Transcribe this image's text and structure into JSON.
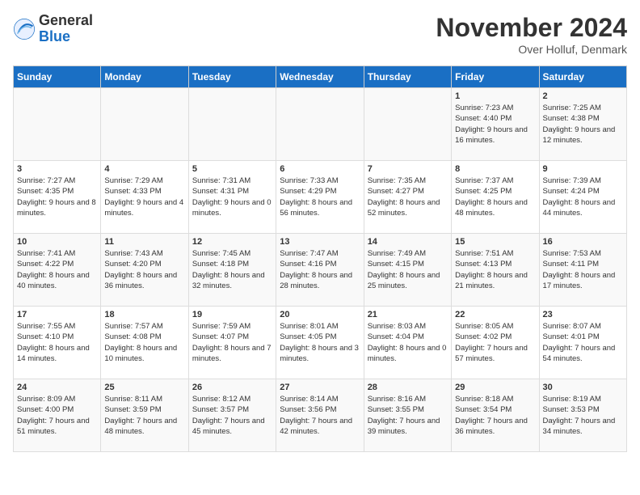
{
  "logo": {
    "general": "General",
    "blue": "Blue"
  },
  "title": "November 2024",
  "location": "Over Holluf, Denmark",
  "weekdays": [
    "Sunday",
    "Monday",
    "Tuesday",
    "Wednesday",
    "Thursday",
    "Friday",
    "Saturday"
  ],
  "weeks": [
    [
      {
        "day": "",
        "info": ""
      },
      {
        "day": "",
        "info": ""
      },
      {
        "day": "",
        "info": ""
      },
      {
        "day": "",
        "info": ""
      },
      {
        "day": "",
        "info": ""
      },
      {
        "day": "1",
        "info": "Sunrise: 7:23 AM\nSunset: 4:40 PM\nDaylight: 9 hours and 16 minutes."
      },
      {
        "day": "2",
        "info": "Sunrise: 7:25 AM\nSunset: 4:38 PM\nDaylight: 9 hours and 12 minutes."
      }
    ],
    [
      {
        "day": "3",
        "info": "Sunrise: 7:27 AM\nSunset: 4:35 PM\nDaylight: 9 hours and 8 minutes."
      },
      {
        "day": "4",
        "info": "Sunrise: 7:29 AM\nSunset: 4:33 PM\nDaylight: 9 hours and 4 minutes."
      },
      {
        "day": "5",
        "info": "Sunrise: 7:31 AM\nSunset: 4:31 PM\nDaylight: 9 hours and 0 minutes."
      },
      {
        "day": "6",
        "info": "Sunrise: 7:33 AM\nSunset: 4:29 PM\nDaylight: 8 hours and 56 minutes."
      },
      {
        "day": "7",
        "info": "Sunrise: 7:35 AM\nSunset: 4:27 PM\nDaylight: 8 hours and 52 minutes."
      },
      {
        "day": "8",
        "info": "Sunrise: 7:37 AM\nSunset: 4:25 PM\nDaylight: 8 hours and 48 minutes."
      },
      {
        "day": "9",
        "info": "Sunrise: 7:39 AM\nSunset: 4:24 PM\nDaylight: 8 hours and 44 minutes."
      }
    ],
    [
      {
        "day": "10",
        "info": "Sunrise: 7:41 AM\nSunset: 4:22 PM\nDaylight: 8 hours and 40 minutes."
      },
      {
        "day": "11",
        "info": "Sunrise: 7:43 AM\nSunset: 4:20 PM\nDaylight: 8 hours and 36 minutes."
      },
      {
        "day": "12",
        "info": "Sunrise: 7:45 AM\nSunset: 4:18 PM\nDaylight: 8 hours and 32 minutes."
      },
      {
        "day": "13",
        "info": "Sunrise: 7:47 AM\nSunset: 4:16 PM\nDaylight: 8 hours and 28 minutes."
      },
      {
        "day": "14",
        "info": "Sunrise: 7:49 AM\nSunset: 4:15 PM\nDaylight: 8 hours and 25 minutes."
      },
      {
        "day": "15",
        "info": "Sunrise: 7:51 AM\nSunset: 4:13 PM\nDaylight: 8 hours and 21 minutes."
      },
      {
        "day": "16",
        "info": "Sunrise: 7:53 AM\nSunset: 4:11 PM\nDaylight: 8 hours and 17 minutes."
      }
    ],
    [
      {
        "day": "17",
        "info": "Sunrise: 7:55 AM\nSunset: 4:10 PM\nDaylight: 8 hours and 14 minutes."
      },
      {
        "day": "18",
        "info": "Sunrise: 7:57 AM\nSunset: 4:08 PM\nDaylight: 8 hours and 10 minutes."
      },
      {
        "day": "19",
        "info": "Sunrise: 7:59 AM\nSunset: 4:07 PM\nDaylight: 8 hours and 7 minutes."
      },
      {
        "day": "20",
        "info": "Sunrise: 8:01 AM\nSunset: 4:05 PM\nDaylight: 8 hours and 3 minutes."
      },
      {
        "day": "21",
        "info": "Sunrise: 8:03 AM\nSunset: 4:04 PM\nDaylight: 8 hours and 0 minutes."
      },
      {
        "day": "22",
        "info": "Sunrise: 8:05 AM\nSunset: 4:02 PM\nDaylight: 7 hours and 57 minutes."
      },
      {
        "day": "23",
        "info": "Sunrise: 8:07 AM\nSunset: 4:01 PM\nDaylight: 7 hours and 54 minutes."
      }
    ],
    [
      {
        "day": "24",
        "info": "Sunrise: 8:09 AM\nSunset: 4:00 PM\nDaylight: 7 hours and 51 minutes."
      },
      {
        "day": "25",
        "info": "Sunrise: 8:11 AM\nSunset: 3:59 PM\nDaylight: 7 hours and 48 minutes."
      },
      {
        "day": "26",
        "info": "Sunrise: 8:12 AM\nSunset: 3:57 PM\nDaylight: 7 hours and 45 minutes."
      },
      {
        "day": "27",
        "info": "Sunrise: 8:14 AM\nSunset: 3:56 PM\nDaylight: 7 hours and 42 minutes."
      },
      {
        "day": "28",
        "info": "Sunrise: 8:16 AM\nSunset: 3:55 PM\nDaylight: 7 hours and 39 minutes."
      },
      {
        "day": "29",
        "info": "Sunrise: 8:18 AM\nSunset: 3:54 PM\nDaylight: 7 hours and 36 minutes."
      },
      {
        "day": "30",
        "info": "Sunrise: 8:19 AM\nSunset: 3:53 PM\nDaylight: 7 hours and 34 minutes."
      }
    ]
  ]
}
